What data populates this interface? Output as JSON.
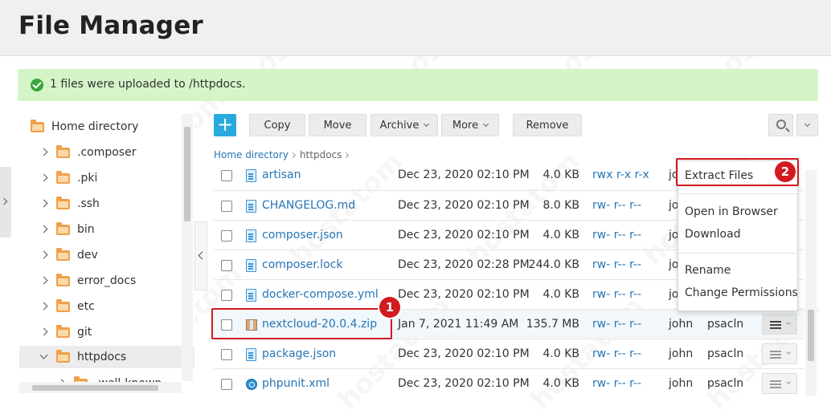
{
  "header": {
    "title": "File Manager"
  },
  "alert": {
    "message": "1 files were uploaded to /httpdocs."
  },
  "tree": {
    "items": [
      {
        "label": "Home directory"
      },
      {
        "label": ".composer"
      },
      {
        "label": ".pki"
      },
      {
        "label": ".ssh"
      },
      {
        "label": "bin"
      },
      {
        "label": "dev"
      },
      {
        "label": "error_docs"
      },
      {
        "label": "etc"
      },
      {
        "label": "git"
      },
      {
        "label": "httpdocs"
      },
      {
        "label": ".well-known"
      }
    ]
  },
  "toolbar": {
    "add": "+",
    "copy": "Copy",
    "move": "Move",
    "archive": "Archive",
    "more": "More",
    "remove": "Remove"
  },
  "breadcrumb": {
    "home": "Home directory",
    "current": "httpdocs"
  },
  "files": [
    {
      "name": "artisan",
      "date": "Dec 23, 2020 02:10 PM",
      "size": "4.0 KB",
      "perm": "rwx r-x r-x",
      "user": "john",
      "group": ""
    },
    {
      "name": "CHANGELOG.md",
      "date": "Dec 23, 2020 02:10 PM",
      "size": "8.0 KB",
      "perm": "rw- r-- r--",
      "user": "jo",
      "group": ""
    },
    {
      "name": "composer.json",
      "date": "Dec 23, 2020 02:10 PM",
      "size": "4.0 KB",
      "perm": "rw- r-- r--",
      "user": "jo",
      "group": ""
    },
    {
      "name": "composer.lock",
      "date": "Dec 23, 2020 02:28 PM",
      "size": "244.0 KB",
      "perm": "rw- r-- r--",
      "user": "jo",
      "group": ""
    },
    {
      "name": "docker-compose.yml",
      "date": "Dec 23, 2020 02:10 PM",
      "size": "4.0 KB",
      "perm": "rw- r-- r--",
      "user": "jo",
      "group": ""
    },
    {
      "name": "nextcloud-20.0.4.zip",
      "date": "Jan 7, 2021 11:49 AM",
      "size": "135.7 MB",
      "perm": "rw- r-- r--",
      "user": "john",
      "group": "psacln"
    },
    {
      "name": "package.json",
      "date": "Dec 23, 2020 02:10 PM",
      "size": "4.0 KB",
      "perm": "rw- r-- r--",
      "user": "john",
      "group": "psacln"
    },
    {
      "name": "phpunit.xml",
      "date": "Dec 23, 2020 02:10 PM",
      "size": "4.0 KB",
      "perm": "rw- r-- r--",
      "user": "john",
      "group": "psacln"
    }
  ],
  "context_menu": {
    "extract": "Extract Files",
    "open_browser": "Open in Browser",
    "download": "Download",
    "rename": "Rename",
    "change_permissions": "Change Permissions"
  },
  "annotations": {
    "step1": "1",
    "step2": "2"
  },
  "watermark": {
    "text": "hostatom"
  },
  "colors": {
    "accent": "#28aade",
    "link": "#2675b5",
    "alert_bg": "#d5f5c8",
    "annotation": "#d21a1f",
    "folder": "#f0a04b"
  }
}
